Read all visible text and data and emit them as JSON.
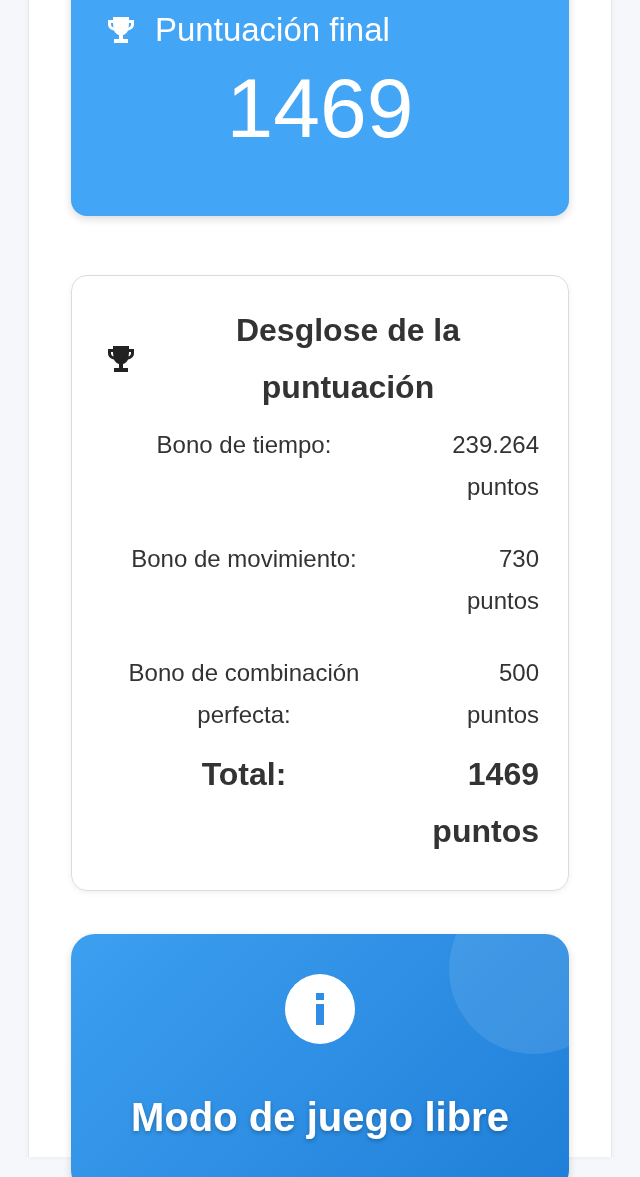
{
  "final_score": {
    "title": "Puntuación final",
    "value": "1469"
  },
  "breakdown": {
    "title": "Desglose de la puntuación",
    "rows": [
      {
        "label": "Bono de tiempo:",
        "value": "239.264 puntos"
      },
      {
        "label": "Bono de movimiento:",
        "value": "730 puntos"
      },
      {
        "label": "Bono de combinación perfecta:",
        "value": "500 puntos"
      }
    ],
    "total": {
      "label": "Total:",
      "value": "1469 puntos"
    }
  },
  "mode_card": {
    "title": "Modo de juego libre"
  }
}
